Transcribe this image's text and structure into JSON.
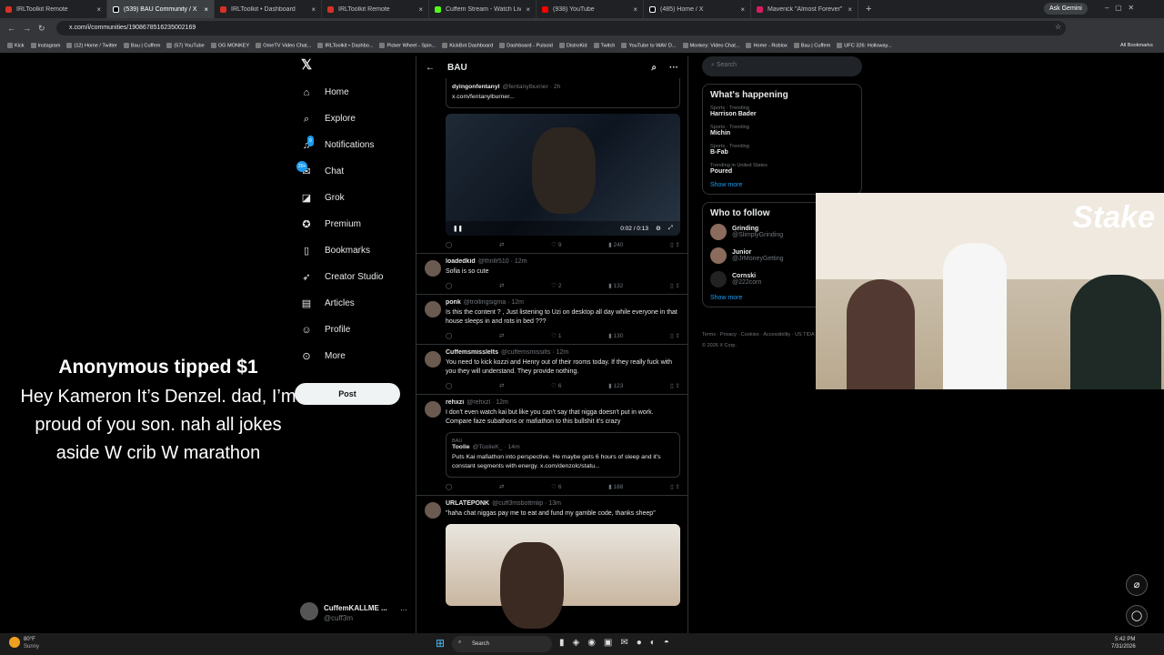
{
  "browser": {
    "tabs": [
      {
        "label": "IRLToolkit Remote"
      },
      {
        "label": "(539) BAU Community / X"
      },
      {
        "label": "IRLToolkit • Dashboard"
      },
      {
        "label": "IRLToolkit Remote"
      },
      {
        "label": "Cuffem Stream - Watch Live on"
      },
      {
        "label": "(938) YouTube"
      },
      {
        "label": "(485) Home / X"
      },
      {
        "label": "Maverick \"Almost Forever\" EP"
      }
    ],
    "ask_label": "Ask Gemini",
    "url": "x.com/i/communities/1908678516235002169",
    "bookmarks": [
      "Kick",
      "Instagram",
      "(12) Home / Twitter",
      "Bau | Cuffem",
      "(57) YouTube",
      "OG MONKEY",
      "OmeTV Video Chat...",
      "IRLToolkit • Dashbo...",
      "Picker Wheel - Spin...",
      "KickBot Dashboard",
      "Dashboard - Pulsoid",
      "DistroKid",
      "Twitch",
      "YouTube to WAV D...",
      "Monkey: Video Chat...",
      "Home - Roblox",
      "Bau | Cuffem",
      "UFC 326: Holloway..."
    ],
    "all_bookmarks": "All Bookmarks"
  },
  "sidebar": {
    "items": [
      "Home",
      "Explore",
      "Notifications",
      "Chat",
      "Grok",
      "Premium",
      "Bookmarks",
      "Creator Studio",
      "Articles",
      "Profile",
      "More"
    ],
    "notif_badge": "9",
    "chat_badge": "20+",
    "post_label": "Post",
    "account_name": "CuffemKALLME ...",
    "account_handle": "@cuff3m"
  },
  "overlay": {
    "tip_header": "Anonymous tipped $1",
    "tip_message": "Hey Kameron It’s Denzel. dad, I’m proud of you son. nah all jokes aside W crib W marathon"
  },
  "main": {
    "title": "BAU",
    "posts": [
      {
        "name": "dyingonfentanyl",
        "handle": "@fentanylburner · 2h",
        "text": "x.com/fentanylburner...",
        "time": "0:02 / 0:13",
        "r": "",
        "rt": "",
        "l": "9",
        "v": "240"
      },
      {
        "name": "loadedkid",
        "handle": "@thrillr510 · 12m",
        "text": "Sofia is so cute",
        "r": "",
        "rt": "",
        "l": "2",
        "v": "132"
      },
      {
        "name": "ponk",
        "handle": "@trollingsigma · 12m",
        "text": "Is this the content ? , Just listening to Uzi on desktop all day while everyone in that house sleeps in and rots in bed ???",
        "r": "",
        "rt": "",
        "l": "1",
        "v": "130"
      },
      {
        "name": "Cuffemsmisslelts",
        "handle": "@cuffemsmissilts · 12m",
        "text": "You need to kick kozzi and Henry out of their rooms today. If they really fuck with you they will understand.  They provide nothing.",
        "r": "",
        "rt": "",
        "l": "6",
        "v": "123"
      },
      {
        "name": "rehxzi",
        "handle": "@rehxzl · 12m",
        "text": "I don't even watch kai but like you can't say that nigga doesn't put in work. Compare faze subathons or mafiathon to this bullshit it's crazy",
        "quote_comm": "BAU",
        "quote_name": "Toolie",
        "quote_handle": "@ToolieK_ · 14m",
        "quote_text": "Puts Kai mafiathon into perspective. He maybe gets 6 hours of sleep and it's constant segments with energy. x.com/denzolc/statu...",
        "r": "",
        "rt": "",
        "l": "6",
        "v": "188"
      },
      {
        "name": "URLATEPONK",
        "handle": "@cuff3msbottmlip · 13m",
        "text": "\"haha chat niggas pay me to eat and fund my gamble code, thanks sheep\""
      }
    ]
  },
  "right": {
    "search_placeholder": "Search",
    "happening_title": "What's happening",
    "trends": [
      {
        "c": "Sports · Trending",
        "t": "Harrison Bader"
      },
      {
        "c": "Sports · Trending",
        "t": "Michin"
      },
      {
        "c": "Sports · Trending",
        "t": "B-Fab"
      },
      {
        "c": "Trending in United States",
        "t": "Poured"
      }
    ],
    "show_more": "Show more",
    "follow_title": "Who to follow",
    "follows": [
      {
        "n": "Grinding",
        "h": "@SlimplyGrinding"
      },
      {
        "n": "Junior",
        "h": "@JrMoneyGetting"
      },
      {
        "n": "Cornski",
        "h": "@222corn"
      }
    ],
    "footer": "Terms · Privacy · Cookies · Accessibility · US TIDA · Ads info · More ... © 2026 X Corp."
  },
  "webcam": {
    "logo": "Stake"
  },
  "taskbar": {
    "weather_temp": "80°F",
    "weather_desc": "Sunny",
    "search": "Search",
    "time": "5:42 PM",
    "date": "7/31/2026"
  }
}
